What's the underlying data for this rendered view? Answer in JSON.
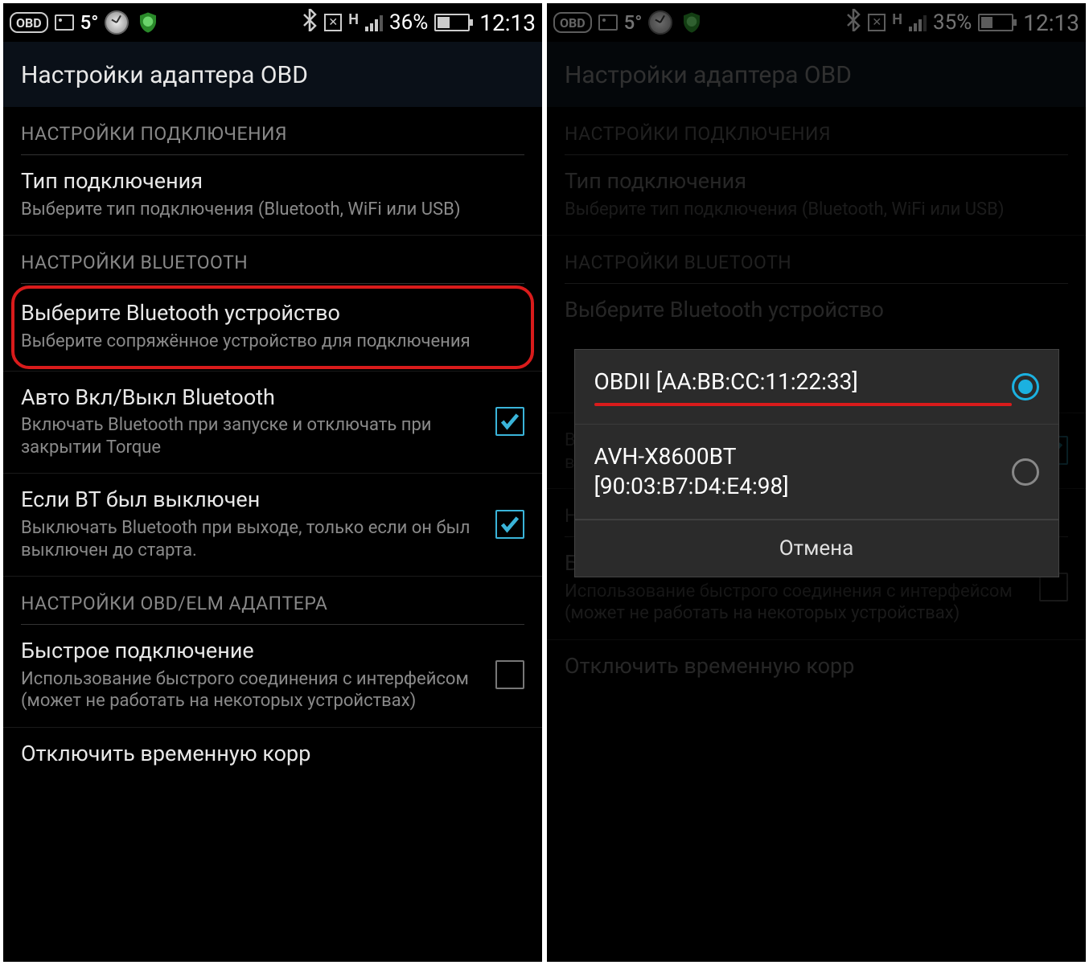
{
  "screens": {
    "left": {
      "status": {
        "temp": "5°",
        "battery_pct": "36%",
        "battery_fill": 36,
        "time": "12:13"
      },
      "header": {
        "title": "Настройки адаптера OBD"
      },
      "sections": {
        "s0": {
          "label": "НАСТРОЙКИ ПОДКЛЮЧЕНИЯ"
        },
        "s1": {
          "label": "НАСТРОЙКИ BLUETOOTH"
        },
        "s2": {
          "label": "НАСТРОЙКИ OBD/ELM АДАПТЕРА"
        }
      },
      "items": {
        "conn_type": {
          "title": "Тип подключения",
          "desc": "Выберите тип подключения (Bluetooth, WiFi или USB)"
        },
        "select_bt": {
          "title": "Выберите Bluetooth устройство",
          "desc": "Выберите сопряжённое устройство для подключения"
        },
        "auto_bt": {
          "title": "Авто Вкл/Выкл Bluetooth",
          "desc": "Включать Bluetooth при запуске и отключать при закрытии Torque",
          "checked": true
        },
        "if_bt_off": {
          "title": "Если BT был выключен",
          "desc": "Выключать Bluetooth при выходе, только если он был выключен до старта.",
          "checked": true
        },
        "fast_conn": {
          "title": "Быстрое подключение",
          "desc": "Использование быстрого соединения с интерфейсом (может не работать на некоторых устройствах)",
          "checked": false
        },
        "disable_tmp": {
          "title": "Отключить временную корр"
        }
      }
    },
    "right": {
      "status": {
        "temp": "5°",
        "battery_pct": "35%",
        "battery_fill": 35,
        "time": "12:13"
      },
      "header": {
        "title": "Настройки адаптера OBD"
      },
      "sections": {
        "s0": {
          "label": "НАСТРОЙКИ ПОДКЛЮЧЕНИЯ"
        },
        "s1": {
          "label": "НАСТРОЙКИ BLUETOOTH"
        },
        "s2": {
          "label": "НАСТРОЙКИ OBD/ELM АДАПТЕРА"
        }
      },
      "items": {
        "conn_type": {
          "title": "Тип подключения",
          "desc": "Выберите тип подключения (Bluetooth, WiFi или USB)"
        },
        "select_bt": {
          "title": "Выберите Bluetooth устройство",
          "desc": ""
        },
        "if_bt_off": {
          "title": "",
          "desc": "Выключать Bluetooth при выходе, только если он был выключен до старта.",
          "checked": true
        },
        "fast_conn": {
          "title": "Быстрое подключение",
          "desc": "Использование быстрого соединения с интерфейсом (может не работать на некоторых устройствах)",
          "checked": false
        },
        "disable_tmp": {
          "title": "Отключить временную корр"
        }
      },
      "dialog": {
        "option1": "OBDII [AA:BB:CC:11:22:33]",
        "option2_name": "AVH-X8600BT",
        "option2_mac": "[90:03:B7:D4:E4:98]",
        "cancel": "Отмена"
      }
    }
  }
}
